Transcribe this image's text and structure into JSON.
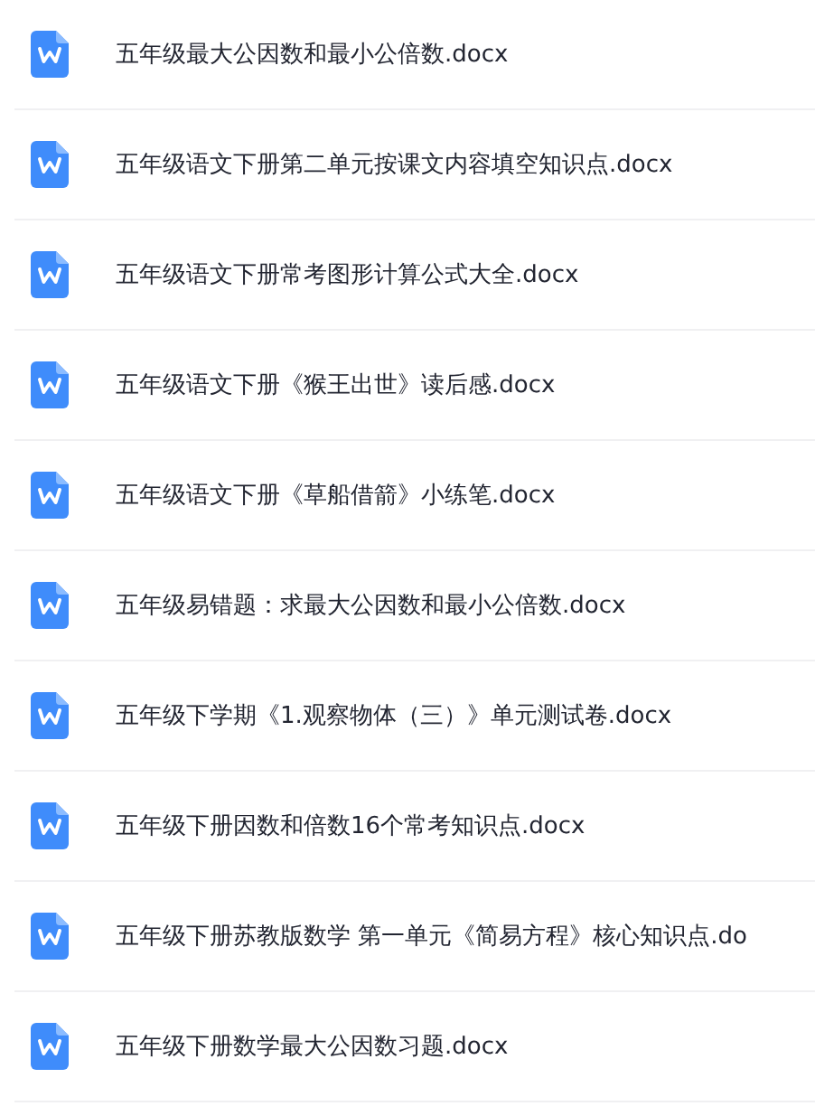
{
  "files": [
    {
      "name": "五年级最大公因数和最小公倍数.docx"
    },
    {
      "name": "五年级语文下册第二单元按课文内容填空知识点.docx"
    },
    {
      "name": "五年级语文下册常考图形计算公式大全.docx"
    },
    {
      "name": "五年级语文下册《猴王出世》读后感.docx"
    },
    {
      "name": "五年级语文下册《草船借箭》小练笔.docx"
    },
    {
      "name": "五年级易错题：求最大公因数和最小公倍数.docx"
    },
    {
      "name": "五年级下学期《1.观察物体（三）》单元测试卷.docx"
    },
    {
      "name": "五年级下册因数和倍数16个常考知识点.docx"
    },
    {
      "name": "五年级下册苏教版数学 第一单元《简易方程》核心知识点.do"
    },
    {
      "name": "五年级下册数学最大公因数习题.docx"
    }
  ]
}
